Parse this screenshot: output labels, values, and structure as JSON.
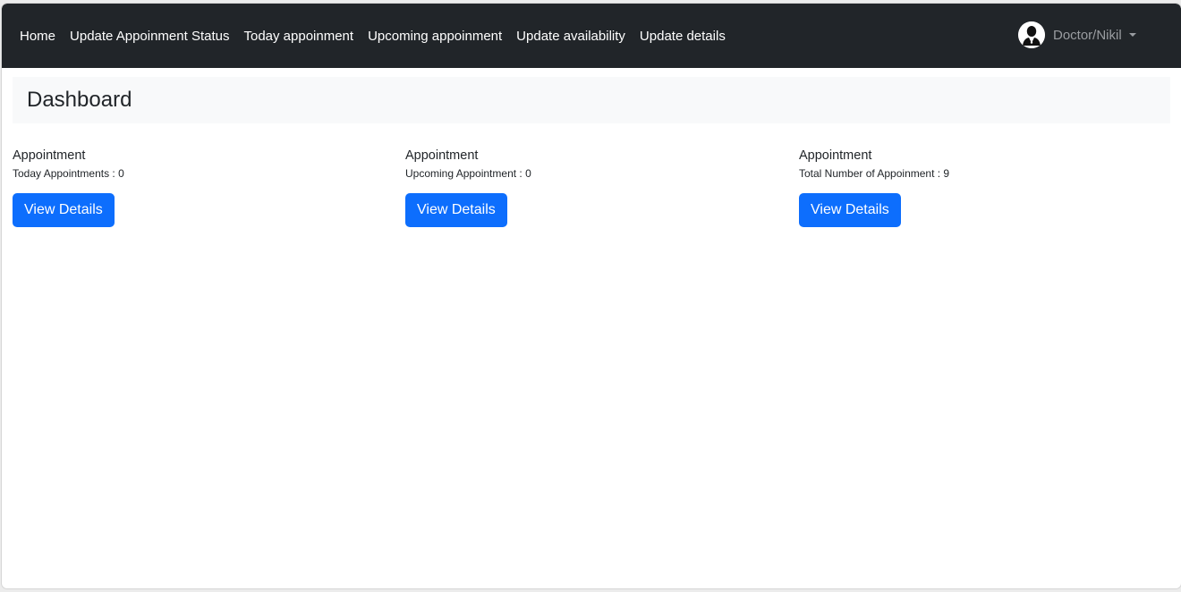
{
  "navbar": {
    "links": [
      {
        "label": "Home"
      },
      {
        "label": "Update Appoinment Status"
      },
      {
        "label": "Today appoinment"
      },
      {
        "label": "Upcoming appoinment"
      },
      {
        "label": "Update availability"
      },
      {
        "label": "Update details"
      }
    ],
    "user": {
      "label": "Doctor/Nikil",
      "avatar_icon": "user-avatar-icon",
      "dropdown_icon": "caret-down-icon"
    },
    "background_color": "#212529"
  },
  "page_header": {
    "title": "Dashboard"
  },
  "cards": [
    {
      "title": "Appointment",
      "text": "Today Appointments : 0",
      "button_label": "View Details"
    },
    {
      "title": "Appointment",
      "text": "Upcoming Appointment : 0",
      "button_label": "View Details"
    },
    {
      "title": "Appointment",
      "text": "Total Number of Appoinment : 9",
      "button_label": "View Details"
    }
  ],
  "colors": {
    "primary_button": "#0d6efd",
    "header_background": "#f8f9fa"
  }
}
